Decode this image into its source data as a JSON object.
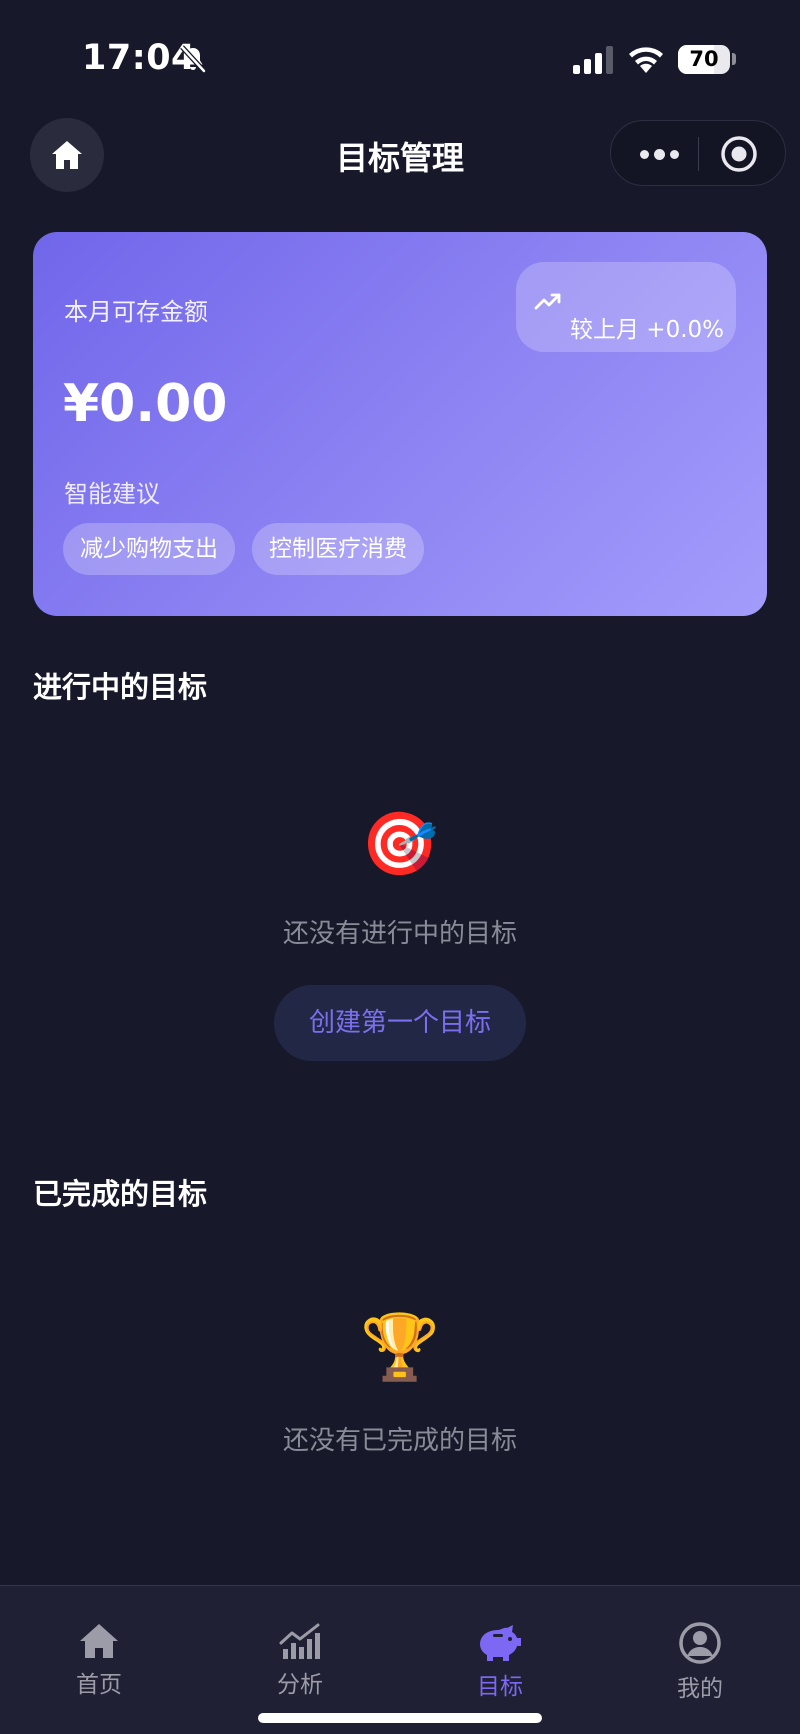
{
  "status_bar": {
    "time": "17:04",
    "battery": "70",
    "battery_level": 0.7,
    "icons": [
      "bell-slash-icon",
      "signal-icon",
      "wifi-icon",
      "battery-icon"
    ]
  },
  "nav": {
    "title": "目标管理",
    "home_icon": "home-icon",
    "more_icon": "more-dots-icon",
    "close_icon": "record-circle-icon"
  },
  "savings_card": {
    "label": "本月可存金额",
    "amount": "¥0.00",
    "trend_icon": "trending-up-icon",
    "trend_text": "较上月 +0.0%",
    "suggestion_title": "智能建议",
    "suggestions": [
      "减少购物支出",
      "控制医疗消费"
    ],
    "gradient": [
      "#7166ea",
      "#a39cfb"
    ]
  },
  "in_progress": {
    "title": "进行中的目标",
    "empty_emoji": "🎯",
    "empty_text": "还没有进行中的目标",
    "create_button": "创建第一个目标"
  },
  "completed": {
    "title": "已完成的目标",
    "empty_emoji": "🏆",
    "empty_text": "还没有已完成的目标"
  },
  "tab_bar": {
    "tabs": [
      {
        "label": "首页",
        "icon": "home-icon",
        "active": false
      },
      {
        "label": "分析",
        "icon": "chart-icon",
        "active": false
      },
      {
        "label": "目标",
        "icon": "piggy-bank-icon",
        "active": true
      },
      {
        "label": "我的",
        "icon": "user-icon",
        "active": false
      }
    ]
  },
  "colors": {
    "background": "#171829",
    "accent": "#7c68f3",
    "tab_bar": "#1f2033"
  }
}
